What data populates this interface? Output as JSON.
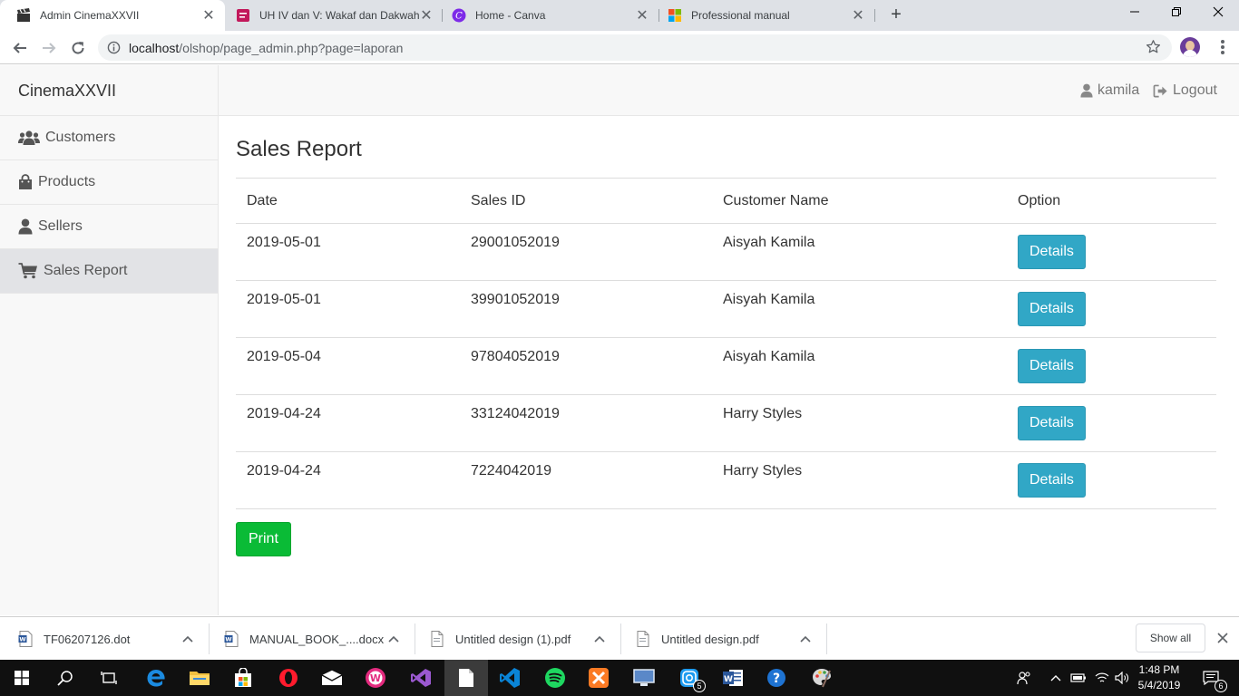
{
  "browser": {
    "tabs": [
      {
        "title": "Admin CinemaXXVII",
        "active": true,
        "icon": "clapperboard-icon"
      },
      {
        "title": "UH IV dan V: Wakaf dan Dakwah",
        "active": false,
        "icon": "form-icon"
      },
      {
        "title": "Home - Canva",
        "active": false,
        "icon": "canva-icon"
      },
      {
        "title": "Professional manual",
        "active": false,
        "icon": "microsoft-icon"
      }
    ],
    "new_tab_label": "+",
    "url_host": "localhost",
    "url_path": "/olshop/page_admin.php?page=laporan"
  },
  "app": {
    "brand": "CinemaXXVII",
    "sidebar": [
      {
        "label": "Customers",
        "icon": "users-icon",
        "active": false
      },
      {
        "label": "Products",
        "icon": "shopping-bag-icon",
        "active": false
      },
      {
        "label": "Sellers",
        "icon": "user-icon",
        "active": false
      },
      {
        "label": "Sales Report",
        "icon": "shopping-cart-icon",
        "active": true
      }
    ],
    "user_label": "kamila",
    "logout_label": "Logout",
    "page_title": "Sales Report",
    "table": {
      "headers": [
        "Date",
        "Sales ID",
        "Customer Name",
        "Option"
      ],
      "rows": [
        {
          "date": "2019-05-01",
          "sales_id": "29001052019",
          "customer": "Aisyah Kamila",
          "action": "Details"
        },
        {
          "date": "2019-05-01",
          "sales_id": "39901052019",
          "customer": "Aisyah Kamila",
          "action": "Details"
        },
        {
          "date": "2019-05-04",
          "sales_id": "97804052019",
          "customer": "Aisyah Kamila",
          "action": "Details"
        },
        {
          "date": "2019-04-24",
          "sales_id": "33124042019",
          "customer": "Harry Styles",
          "action": "Details"
        },
        {
          "date": "2019-04-24",
          "sales_id": "7224042019",
          "customer": "Harry Styles",
          "action": "Details"
        }
      ]
    },
    "print_label": "Print",
    "colors": {
      "details": "#31a7c6",
      "print": "#0abb36"
    }
  },
  "downloads": {
    "items": [
      {
        "name": "TF06207126.dot",
        "icon": "word-file-icon"
      },
      {
        "name": "MANUAL_BOOK_....docx",
        "icon": "word-file-icon"
      },
      {
        "name": "Untitled design (1).pdf",
        "icon": "pdf-file-icon"
      },
      {
        "name": "Untitled design.pdf",
        "icon": "pdf-file-icon"
      }
    ],
    "show_all_label": "Show all"
  },
  "taskbar": {
    "time": "1:48 PM",
    "date": "5/4/2019",
    "notifications_count": "6",
    "instagram_badge": "5"
  }
}
